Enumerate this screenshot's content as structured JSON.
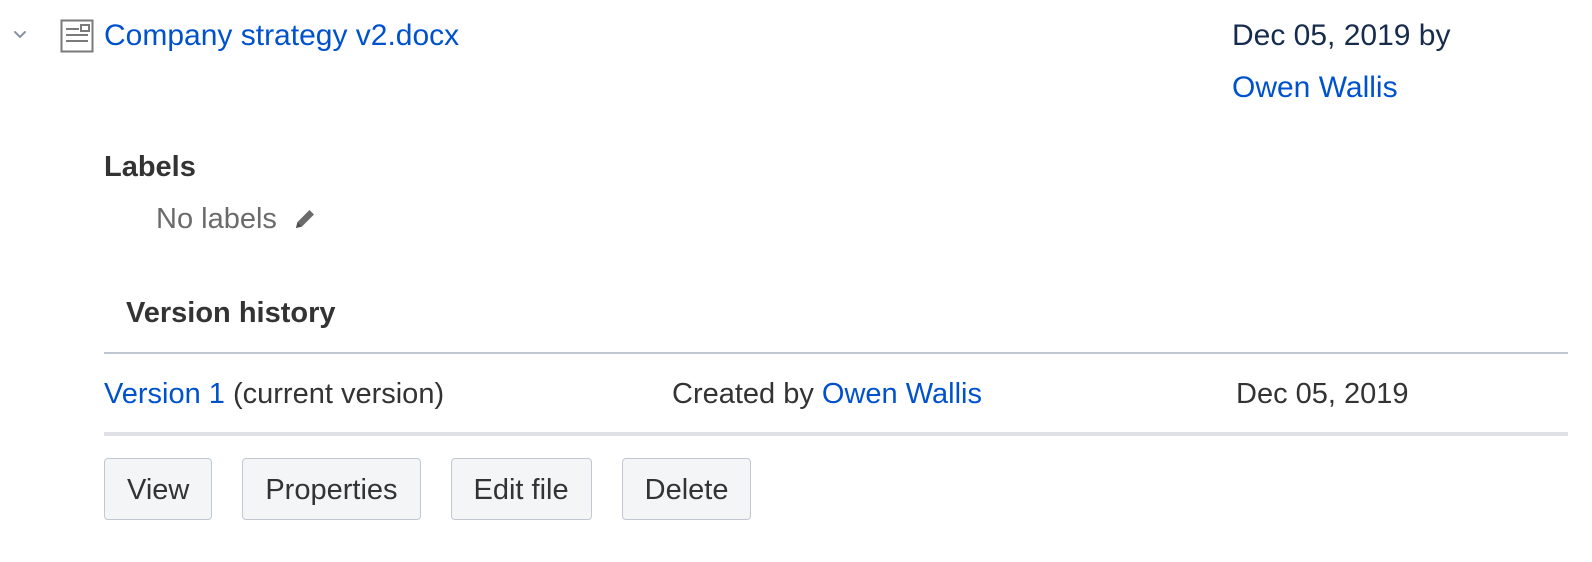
{
  "attachment": {
    "file_name": "Company strategy v2.docx",
    "modified_date": "Dec 05, 2019 by",
    "modified_by": "Owen Wallis"
  },
  "labels": {
    "heading": "Labels",
    "empty_text": "No labels"
  },
  "version_history": {
    "heading": "Version history",
    "rows": [
      {
        "version_link": "Version 1",
        "version_note": "(current version)",
        "created_prefix": "Created by",
        "created_by": "Owen Wallis",
        "date": "Dec 05, 2019"
      }
    ]
  },
  "actions": {
    "view": "View",
    "properties": "Properties",
    "edit_file": "Edit file",
    "delete": "Delete"
  },
  "icons": {
    "chevron": "chevron-down-icon",
    "file": "document-icon",
    "edit": "pencil-icon"
  },
  "colors": {
    "link": "#0052cc",
    "text": "#333333",
    "muted": "#6b6b6b",
    "button_bg": "#f4f5f7"
  }
}
